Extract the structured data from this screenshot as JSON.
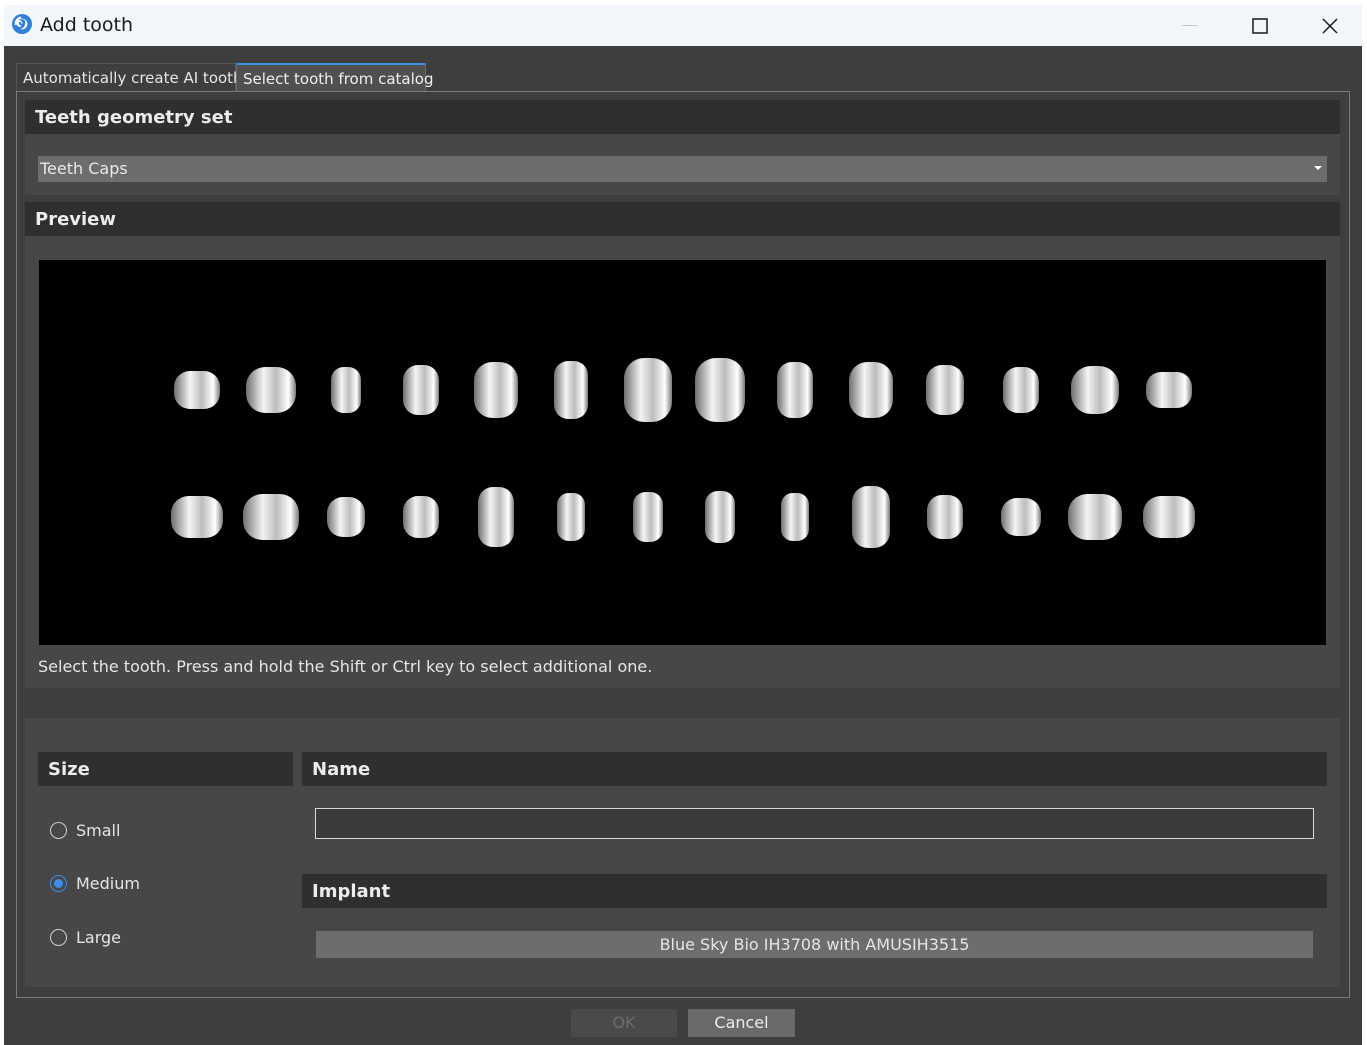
{
  "window": {
    "title": "Add tooth",
    "icon": "app-swirl-icon",
    "controls": [
      "minimize-icon",
      "maximize-icon",
      "close-icon"
    ]
  },
  "tabs": [
    {
      "label": "Automatically create AI tooth",
      "active": false
    },
    {
      "label": "Select tooth from catalog",
      "active": true
    }
  ],
  "geometry": {
    "header": "Teeth geometry set",
    "selected": "Teeth Caps"
  },
  "preview": {
    "header": "Preview",
    "hint": "Select the tooth. Press and hold the Shift or Ctrl key to select additional one.",
    "upper_row_count": 14,
    "lower_row_count": 14
  },
  "size": {
    "header": "Size",
    "options": [
      {
        "label": "Small",
        "checked": false
      },
      {
        "label": "Medium",
        "checked": true
      },
      {
        "label": "Large",
        "checked": false
      }
    ]
  },
  "name": {
    "header": "Name",
    "value": "",
    "placeholder": ""
  },
  "implant": {
    "header": "Implant",
    "value": "Blue Sky Bio IH3708 with AMUSIH3515"
  },
  "buttons": {
    "ok": "OK",
    "cancel": "Cancel",
    "ok_enabled": false
  },
  "colors": {
    "accent": "#3d8ee8",
    "panel": "#474747",
    "header": "#2f2f2f",
    "background": "#3e3e3e"
  }
}
